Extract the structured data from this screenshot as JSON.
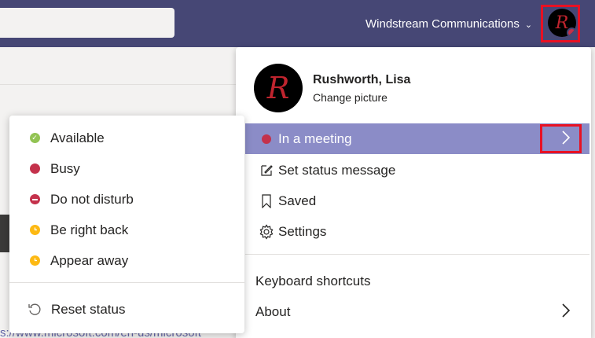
{
  "header": {
    "org_name": "Windstream Communications",
    "org_chevron": "⌄",
    "avatar_letter": "R"
  },
  "background": {
    "link_text": "s://www.microsoft.com/en-us/microsoft"
  },
  "profile": {
    "name": "Rushworth, Lisa",
    "change_picture": "Change picture",
    "avatar_letter": "R"
  },
  "menu": {
    "in_meeting": "In a meeting",
    "set_status": "Set status message",
    "saved": "Saved",
    "settings": "Settings",
    "keyboard": "Keyboard shortcuts",
    "about": "About"
  },
  "status_menu": {
    "items": [
      {
        "label": "Available",
        "color": "#92c353"
      },
      {
        "label": "Busy",
        "color": "#c4314b"
      },
      {
        "label": "Do not disturb",
        "color": "#c4314b"
      },
      {
        "label": "Be right back",
        "color": "#fdb913"
      },
      {
        "label": "Appear away",
        "color": "#fdb913"
      }
    ],
    "reset": "Reset status"
  },
  "colors": {
    "topbar": "#464775",
    "highlight": "#8b8cc7",
    "busy": "#c4314b"
  }
}
